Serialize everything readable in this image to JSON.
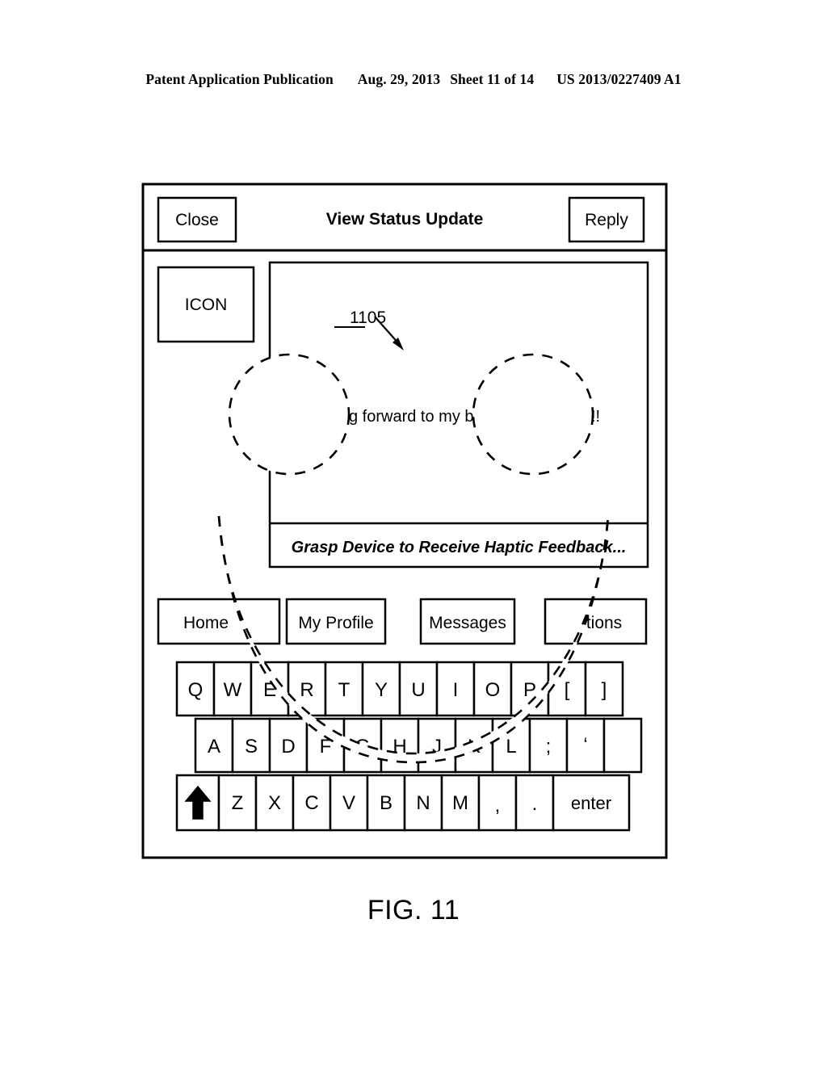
{
  "publication_header": {
    "left": "Patent Application Publication",
    "date": "Aug. 29, 2013",
    "sheet": "Sheet 11 of 14",
    "number": "US 2013/0227409 A1"
  },
  "figure": {
    "caption": "FIG. 11",
    "reference_numeral": "1105"
  },
  "device": {
    "toolbar": {
      "close_label": "Close",
      "title": "View Status Update",
      "reply_label": "Reply"
    },
    "content": {
      "icon_label": "ICON",
      "message_visible_left": "g forward to my bea",
      "message_visible_right": "!!",
      "haptic_prompt": "Grasp Device to Receive Haptic Feedback..."
    },
    "navigation": [
      {
        "label": "Home",
        "visible_label": "Home"
      },
      {
        "label": "My Profile",
        "visible_label": "My Profile"
      },
      {
        "label": "Messages",
        "visible_label": "Messages"
      },
      {
        "label": "Options",
        "visible_label": "tions"
      }
    ],
    "keyboard": {
      "row1": [
        "Q",
        "W",
        "E",
        "R",
        "T",
        "Y",
        "U",
        "I",
        "O",
        "P",
        "[",
        "]"
      ],
      "row1_visible": [
        "Q",
        "W",
        "E",
        "",
        "",
        "",
        "",
        "",
        "",
        "",
        "[",
        "]"
      ],
      "row2": [
        "A",
        "S",
        "D",
        "F",
        "G",
        "H",
        "J",
        "K",
        "L",
        ";",
        "'",
        ""
      ],
      "row2_visible": [
        "A",
        "S",
        "D",
        "F",
        "G",
        "",
        "",
        "",
        "L",
        ";",
        "'",
        ""
      ],
      "row3": [
        "shift",
        "Z",
        "X",
        "C",
        "V",
        "B",
        "N",
        "M",
        ",",
        ".",
        "enter"
      ],
      "row3_visible": [
        "↑",
        "Z",
        "X",
        "C",
        "V",
        "B",
        "N",
        "M",
        ",",
        ".",
        "enter"
      ],
      "shift_icon": "up-arrow",
      "enter_label": "enter"
    }
  },
  "overlay": {
    "name": "smiley-face-haptic-pattern",
    "style": "dashed",
    "parts": [
      "left-eye",
      "right-eye",
      "mouth-crescent"
    ]
  },
  "colors": {
    "ink": "#000000",
    "paper": "#ffffff"
  }
}
